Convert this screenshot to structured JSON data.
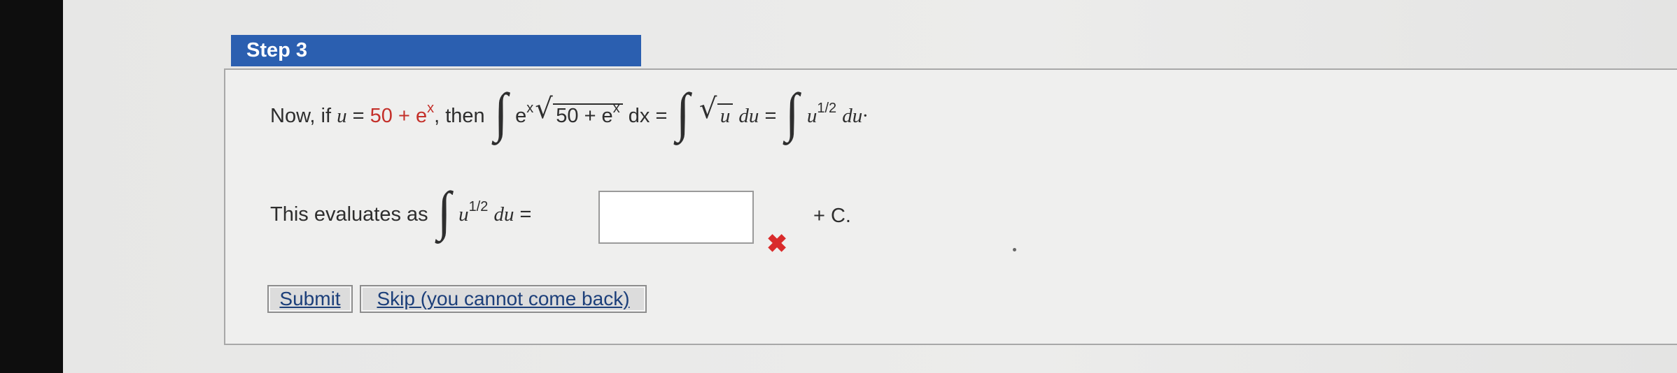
{
  "step": {
    "title": "Step 3"
  },
  "line1": {
    "prefix": "Now, if",
    "u_var": "u",
    "eq1": "=",
    "sub_value": "50 +",
    "e_base": "e",
    "x_exp": "x",
    "comma_then": ", then",
    "integral_symbol": "∫",
    "int1_factor_base": "e",
    "int1_factor_exp": "x",
    "sqrt_symbol": "√",
    "sqrt_content_a": "50 + e",
    "sqrt_content_exp": "x",
    "dx": "dx",
    "eq2": "=",
    "sqrt_u": "u",
    "du1": "du",
    "eq3": "=",
    "u_pow_base": "u",
    "u_pow_exp": "1/2",
    "du2": "du·"
  },
  "line2": {
    "prefix": "This evaluates as",
    "integral_symbol": "∫",
    "u_pow_base": "u",
    "u_pow_exp": "1/2",
    "du": "du",
    "eq": "=",
    "answer_value": "",
    "wrong_mark": "✖",
    "suffix": "+ C."
  },
  "buttons": {
    "submit": "Submit",
    "skip": "Skip (you cannot come back)"
  },
  "colors": {
    "header": "#2b5fb0",
    "substitution": "#c4302a",
    "wrong": "#d92b2b"
  }
}
